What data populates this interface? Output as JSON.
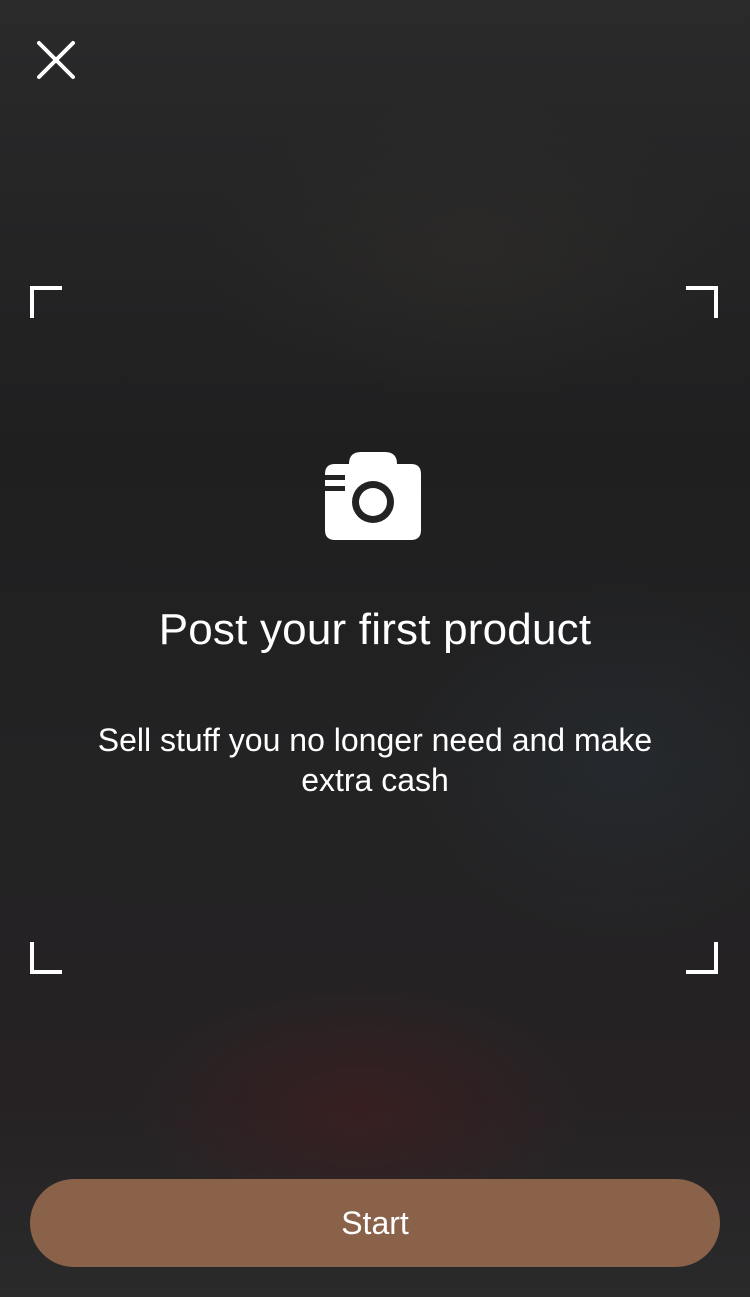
{
  "close": {
    "icon": "close-icon"
  },
  "camera": {
    "icon": "camera-icon"
  },
  "content": {
    "title": "Post your first product",
    "subtitle": "Sell stuff you no longer need and make extra cash"
  },
  "start": {
    "label": "Start"
  },
  "colors": {
    "background": "#232324",
    "button": "#8a624a",
    "text": "#ffffff"
  }
}
